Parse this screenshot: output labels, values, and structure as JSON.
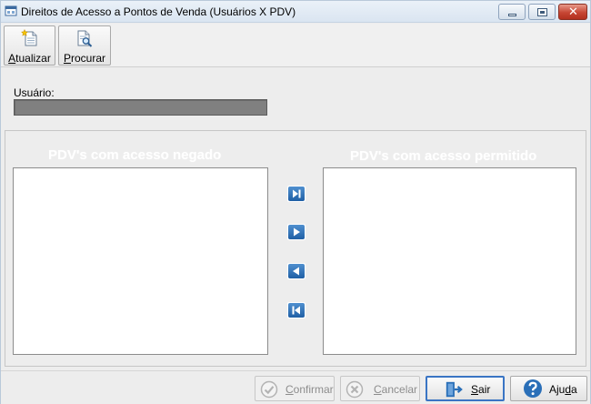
{
  "window": {
    "title": "Direitos de Acesso a Pontos de Venda  (Usuários X PDV)"
  },
  "toolbar": {
    "atualizar": {
      "first": "A",
      "rest": "tualizar",
      "icon": "new-document-star-icon"
    },
    "procurar": {
      "first": "P",
      "rest": "rocurar",
      "icon": "document-search-icon"
    }
  },
  "user": {
    "label": "Usuário:",
    "value": ""
  },
  "lists": {
    "denied_title": "PDV's com acesso negado",
    "allowed_title": "PDV's com acesso permitido",
    "denied_items": [],
    "allowed_items": []
  },
  "move_buttons": [
    {
      "name": "move-all-right",
      "icon": "skip-forward-icon"
    },
    {
      "name": "move-right",
      "icon": "play-right-icon"
    },
    {
      "name": "move-left",
      "icon": "play-left-icon"
    },
    {
      "name": "move-all-left",
      "icon": "skip-back-icon"
    }
  ],
  "buttons": {
    "confirmar": {
      "first": "C",
      "rest": "onfirmar",
      "enabled": false
    },
    "cancelar": {
      "first": "C",
      "rest": "ancelar",
      "enabled": false
    },
    "sair": {
      "first": "S",
      "rest": "air",
      "enabled": true
    },
    "ajuda": {
      "pre": "Aju",
      "ul": "d",
      "post": "a",
      "enabled": true
    }
  },
  "colors": {
    "accent": "#2a6fb8",
    "list_title": "#ffffff",
    "user_field": "#808080"
  }
}
